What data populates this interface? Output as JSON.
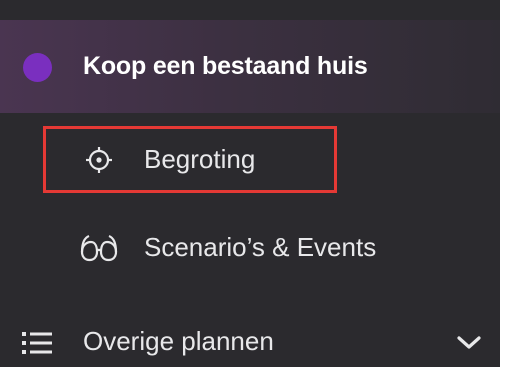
{
  "plan": {
    "title": "Koop een bestaand huis",
    "dot_color": "#7a2fbf"
  },
  "nav": {
    "items": [
      {
        "label": "Begroting",
        "icon": "crosshair-icon",
        "highlighted": true,
        "highlight_color": "#e53935"
      },
      {
        "label": "Scenario’s & Events",
        "icon": "glasses-icon",
        "highlighted": false
      }
    ]
  },
  "section": {
    "label": "Overige plannen",
    "icon": "list-icon",
    "toggle_icon": "chevron-down-icon"
  },
  "colors": {
    "panel_bg": "#2b2a2e",
    "text": "#e8e8ea"
  }
}
